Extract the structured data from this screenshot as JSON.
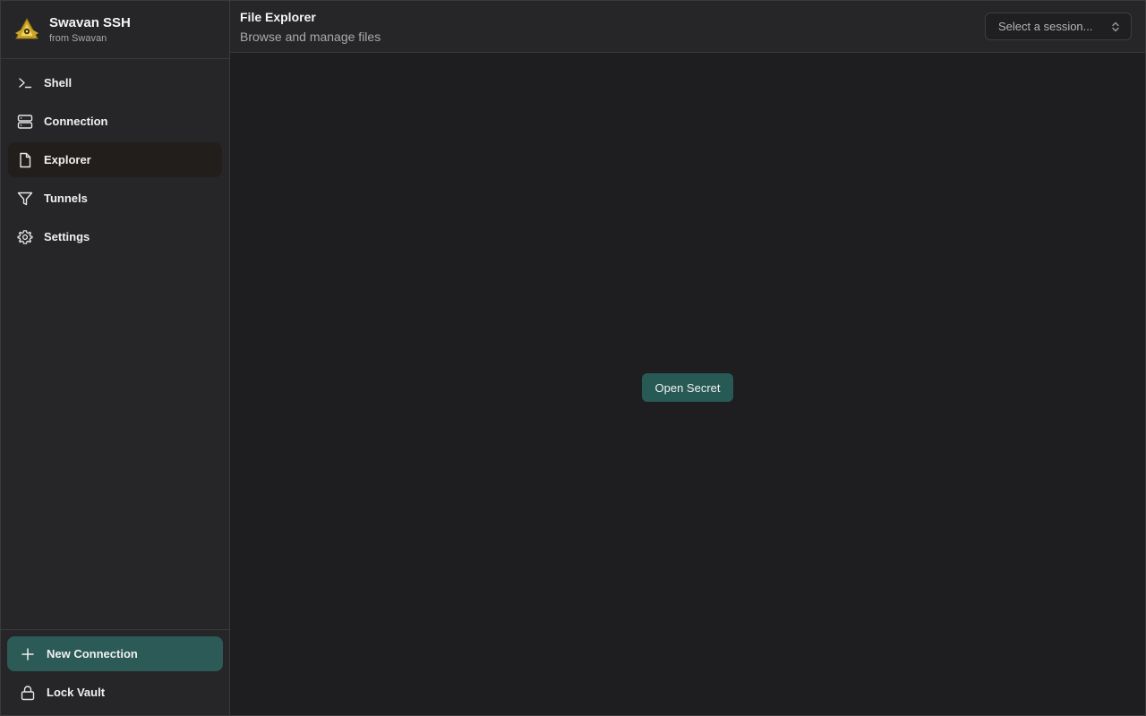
{
  "brand": {
    "title": "Swavan SSH",
    "subtitle": "from Swavan",
    "logo_icon": "swavan-logo-icon"
  },
  "sidebar": {
    "items": [
      {
        "label": "Shell",
        "icon": "terminal-icon",
        "active": false
      },
      {
        "label": "Connection",
        "icon": "server-icon",
        "active": false
      },
      {
        "label": "Explorer",
        "icon": "file-icon",
        "active": true
      },
      {
        "label": "Tunnels",
        "icon": "filter-icon",
        "active": false
      },
      {
        "label": "Settings",
        "icon": "gear-icon",
        "active": false
      }
    ],
    "new_connection_label": "New Connection",
    "lock_vault_label": "Lock Vault"
  },
  "header": {
    "title": "File Explorer",
    "subtitle": "Browse and manage files",
    "session_placeholder": "Select a session..."
  },
  "main": {
    "open_secret_label": "Open Secret"
  },
  "colors": {
    "accent": "#2b5a57",
    "background": "#1e1e20",
    "sidebar": "#262628"
  }
}
